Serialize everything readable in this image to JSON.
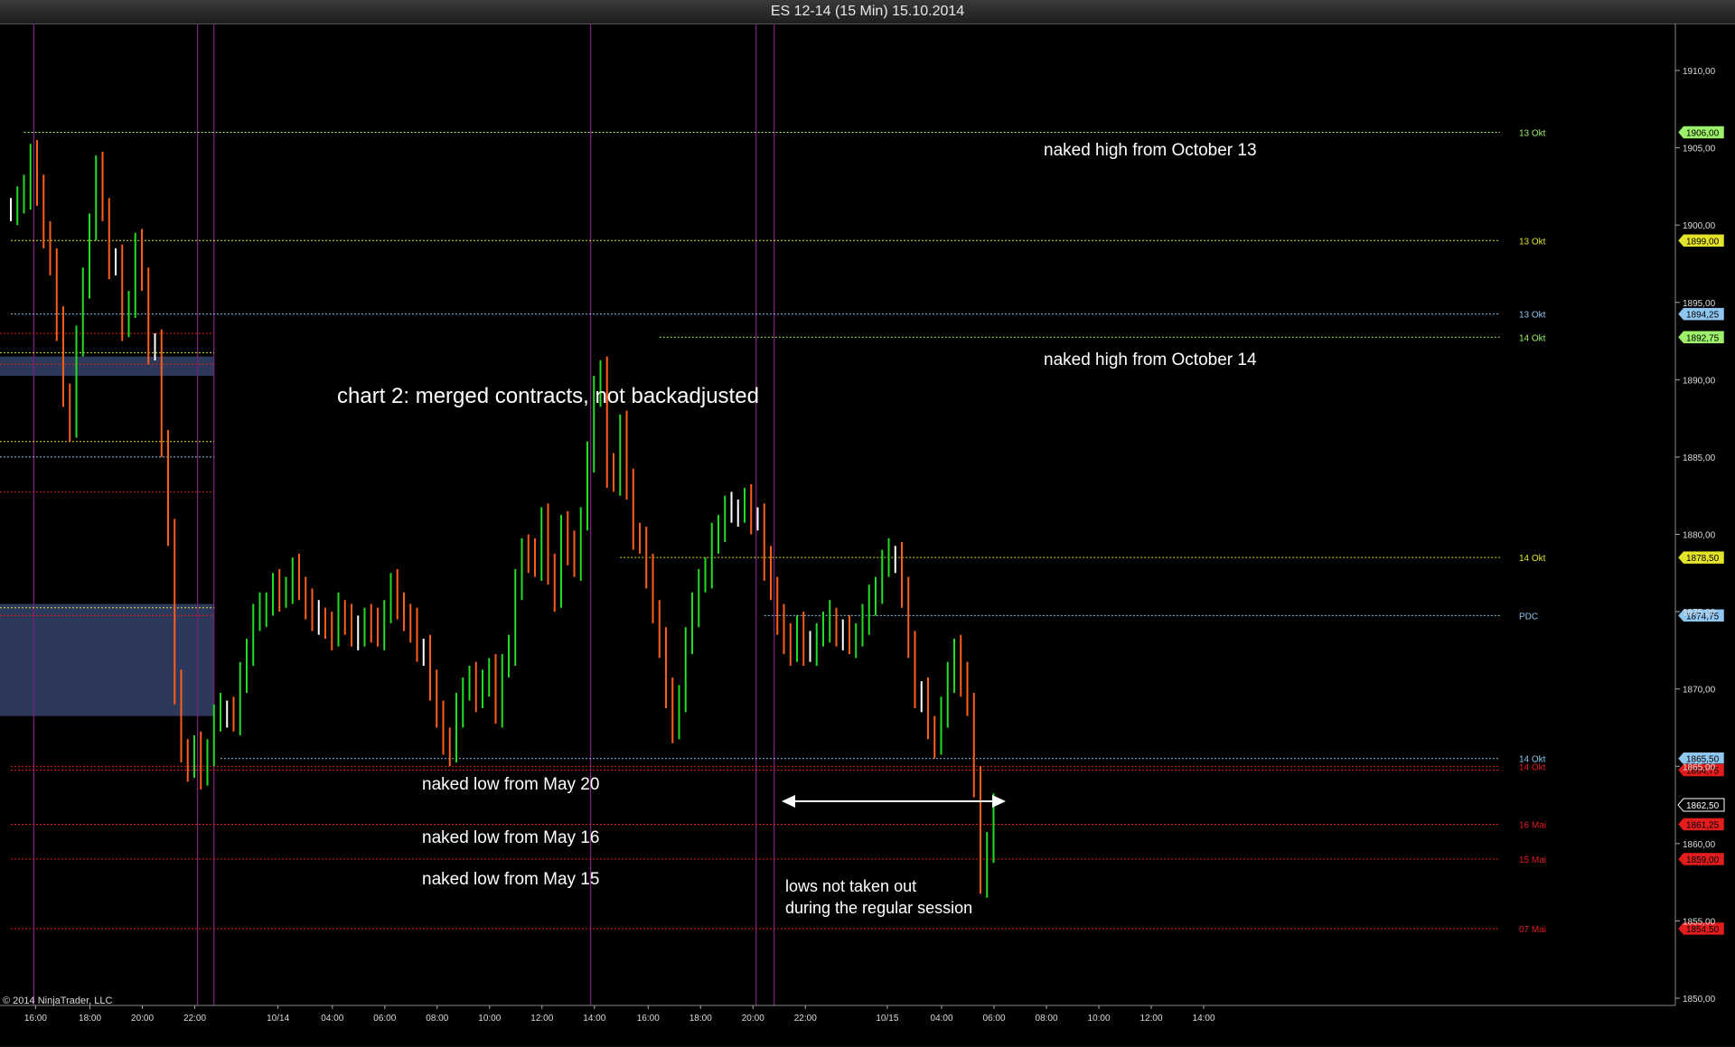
{
  "window": {
    "title": "ES 12-14 (15 Min)  15.10.2014"
  },
  "copyright": "© 2014 NinjaTrader, LLC",
  "colors": {
    "background": "#000000",
    "up_bar": "#22dd22",
    "down_bar": "#ff5e1a",
    "doji_bar": "#ffffff",
    "session_line": "#7a1f7a",
    "red_level": "#e11d1d",
    "yellow_level": "#e3e32a",
    "green_level": "#9cf06a",
    "blue_level": "#8fc6f0",
    "zone_fill": "#2e3c5f",
    "annotation_text": "#ffffff"
  },
  "chart_data": {
    "type": "line",
    "title": "ES 12-14 (15 Min)  15.10.2014",
    "y_axis": {
      "range": [
        1849,
        1914
      ],
      "ticks": [
        "1850,00",
        "1855,00",
        "1860,00",
        "1865,00",
        "1870,00",
        "1875,00",
        "1880,00",
        "1885,00",
        "1890,00",
        "1895,00",
        "1900,00",
        "1905,00",
        "1910,00"
      ],
      "tick_values": [
        1850,
        1855,
        1860,
        1865,
        1870,
        1875,
        1880,
        1885,
        1890,
        1895,
        1900,
        1905,
        1910
      ]
    },
    "x_axis": {
      "labels": [
        "16:00",
        "18:00",
        "20:00",
        "22:00",
        "10/14",
        "04:00",
        "06:00",
        "08:00",
        "10:00",
        "12:00",
        "14:00",
        "16:00",
        "18:00",
        "20:00",
        "22:00",
        "10/15",
        "04:00",
        "06:00",
        "08:00",
        "10:00",
        "12:00",
        "14:00"
      ]
    },
    "price_levels": [
      {
        "label": "13 Okt",
        "value": 1906.0,
        "tag": "1906,00",
        "color": "green",
        "from_bar": 2
      },
      {
        "label": "13 Okt",
        "value": 1899.0,
        "tag": "1899,00",
        "color": "yellow",
        "from_bar": 0
      },
      {
        "label": "13 Okt",
        "value": 1894.25,
        "tag": "1894,25",
        "color": "blue",
        "from_bar": 0
      },
      {
        "label": "14 Okt",
        "value": 1892.75,
        "tag": "1892,75",
        "color": "green",
        "from_bar": 99
      },
      {
        "label": "14 Okt",
        "value": 1878.5,
        "tag": "1878,50",
        "color": "yellow",
        "from_bar": 93
      },
      {
        "label": "PDC",
        "value": 1874.75,
        "tag": "1874,75",
        "color": "blue",
        "from_bar": 115
      },
      {
        "label": "14 Okt",
        "value": 1865.5,
        "tag": "1865,50",
        "color": "blue",
        "from_bar": 32
      },
      {
        "label": "14 Okt",
        "value": 1865.0,
        "tag": "",
        "color": "red",
        "from_bar": 0
      },
      {
        "label": "",
        "value": 1864.75,
        "tag": "1864,75",
        "color": "red",
        "from_bar": 0
      },
      {
        "label": "16 Mai",
        "value": 1861.25,
        "tag": "1861,25",
        "color": "red",
        "from_bar": 0
      },
      {
        "label": "15 Mai",
        "value": 1859.0,
        "tag": "1859,00",
        "color": "red",
        "from_bar": 0
      },
      {
        "label": "07 Mai",
        "value": 1854.5,
        "tag": "1854,50",
        "color": "red",
        "from_bar": 0
      }
    ],
    "current_price": {
      "value": 1862.5,
      "tag": "1862,50"
    },
    "first_session_levels": [
      {
        "value": 1893.0,
        "color": "red"
      },
      {
        "value": 1891.75,
        "color": "yellow"
      },
      {
        "value": 1891.0,
        "color": "red"
      },
      {
        "value": 1886.0,
        "color": "yellow"
      },
      {
        "value": 1885.0,
        "color": "blue"
      },
      {
        "value": 1882.75,
        "color": "red"
      },
      {
        "value": 1875.25,
        "color": "yellow"
      },
      {
        "value": 1874.75,
        "color": "red"
      }
    ],
    "zones": [
      {
        "top": 1891.5,
        "bottom": 1890.25
      },
      {
        "top": 1875.5,
        "bottom": 1868.25
      }
    ],
    "session_separators_bar": [
      3.5,
      28.5,
      31,
      88.5,
      113.75,
      116.5
    ],
    "series": [
      {
        "values": [
          1901.0,
          1901.5,
          1902.0,
          1904.5,
          1902.0,
          1899.5,
          1897.5,
          1893.5,
          1889.0,
          1887.0,
          1892.5,
          1896.0,
          1900.0,
          1903.5,
          1901.0,
          1897.5,
          1897.5,
          1893.5,
          1895.0,
          1898.5,
          1896.5,
          1892.0,
          1892.0,
          1886.0,
          1880.0,
          1870.0,
          1866.0,
          1865.0,
          1866.0,
          1864.5,
          1866.0,
          1868.0,
          1868.5,
          1868.5,
          1868.0,
          1870.5,
          1872.5,
          1874.5,
          1875.0,
          1875.5,
          1876.5,
          1876.0,
          1876.5,
          1877.5,
          1876.5,
          1875.5,
          1874.5,
          1874.5,
          1874.0,
          1873.5,
          1875.0,
          1874.5,
          1873.5,
          1873.5,
          1874.5,
          1874.0,
          1873.5,
          1875.0,
          1876.5,
          1875.5,
          1874.5,
          1874.0,
          1872.5,
          1872.5,
          1870.0,
          1868.5,
          1866.5,
          1866.0,
          1868.5,
          1870.0,
          1870.5,
          1869.5,
          1870.5,
          1871.0,
          1868.5,
          1871.5,
          1872.5,
          1876.5,
          1879.0,
          1878.5,
          1878.0,
          1881.0,
          1877.5,
          1876.0,
          1880.5,
          1879.0,
          1878.0,
          1881.0,
          1885.0,
          1889.0,
          1890.5,
          1884.0,
          1883.5,
          1887.0,
          1883.0,
          1880.0,
          1879.5,
          1877.5,
          1875.0,
          1873.0,
          1869.5,
          1867.5,
          1869.5,
          1873.0,
          1875.0,
          1877.0,
          1877.5,
          1879.5,
          1880.5,
          1881.5,
          1881.5,
          1881.5,
          1882.0,
          1881.0,
          1881.0,
          1878.0,
          1876.5,
          1874.5,
          1873.0,
          1872.5,
          1874.0,
          1872.5,
          1872.5,
          1873.5,
          1874.0,
          1874.5,
          1873.5,
          1873.5,
          1873.0,
          1873.5,
          1874.5,
          1875.5,
          1876.5,
          1878.0,
          1878.5,
          1878.5,
          1876.0,
          1873.0,
          1869.5,
          1869.5,
          1867.5,
          1866.5,
          1868.5,
          1870.5,
          1872.5,
          1870.5,
          1869.0,
          1864.0,
          1857.5,
          1859.5,
          1862.5
        ]
      }
    ]
  },
  "annotations": [
    {
      "id": "chart-title-note",
      "text": "chart 2: merged contracts, not backadjusted"
    },
    {
      "id": "naked-high-oct13",
      "text": "naked high from October 13"
    },
    {
      "id": "naked-high-oct14",
      "text": "naked high from October 14"
    },
    {
      "id": "naked-low-may20",
      "text": "naked low from May 20"
    },
    {
      "id": "naked-low-may16",
      "text": "naked low from May 16"
    },
    {
      "id": "naked-low-may15",
      "text": "naked low from May 15"
    },
    {
      "id": "lows-note-1",
      "text": "lows not taken out"
    },
    {
      "id": "lows-note-2",
      "text": "during the regular session"
    }
  ]
}
